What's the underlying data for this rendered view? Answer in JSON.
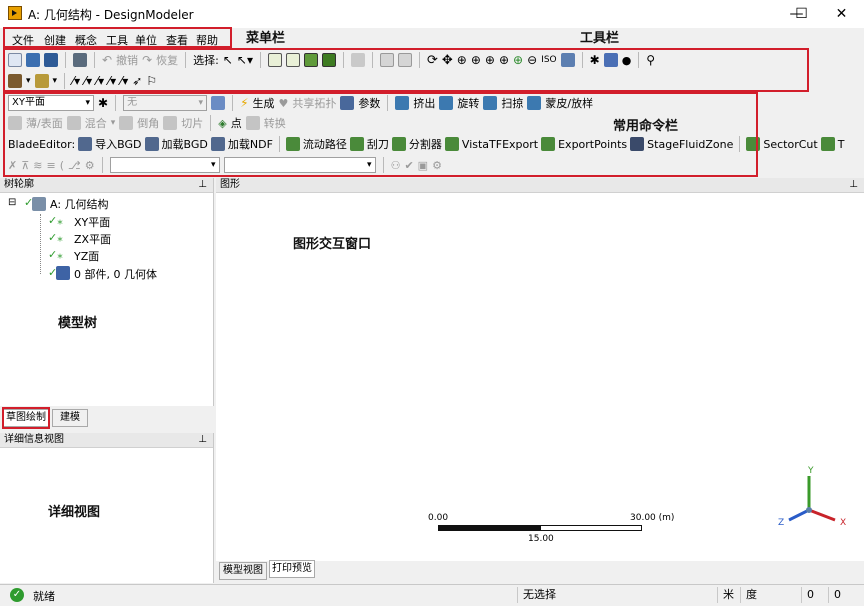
{
  "window": {
    "title": "A: 几何结构 - DesignModeler",
    "min": "—",
    "max": "☐",
    "close": "✕"
  },
  "menu": [
    "文件",
    "创建",
    "概念",
    "工具",
    "单位",
    "查看",
    "帮助"
  ],
  "annotations": {
    "menubar": "菜单栏",
    "toolbar": "工具栏",
    "commandbar": "常用命令栏",
    "graphics": "图形交互窗口",
    "tree": "模型树",
    "details": "详细视图"
  },
  "toolbar1": {
    "undo": "撤销",
    "redo": "恢复",
    "select": "选择:"
  },
  "commands1": {
    "plane": "XY平面",
    "sketch": "无",
    "generate": "生成",
    "share_topo": "共享拓扑",
    "params": "参数",
    "extrude": "挤出",
    "revolve": "旋转",
    "sweep": "扫掠",
    "skin": "蒙皮/放样"
  },
  "commands2": {
    "thin": "薄/表面",
    "blend": "混合",
    "chamfer": "倒角",
    "slice": "切片",
    "point": "点",
    "convert": "转换"
  },
  "commands3": {
    "label": "BladeEditor:",
    "items": [
      "导入BGD",
      "加载BGD",
      "加载NDF",
      "流动路径",
      "刮刀",
      "分割器",
      "VistaTFExport",
      "ExportPoints",
      "StageFluidZone",
      "SectorCut",
      "T"
    ]
  },
  "tree": {
    "header": "树轮廓",
    "pin": "꜖",
    "root": "A: 几何结构",
    "nodes": [
      "XY平面",
      "ZX平面",
      "YZ面",
      "0 部件, 0 几何体"
    ]
  },
  "left_tabs": {
    "sketch": "草图绘制",
    "model": "建模"
  },
  "details": {
    "header": "详细信息视图"
  },
  "graphics": {
    "header": "图形",
    "scale_min": "0.00",
    "scale_max": "30.00 (m)",
    "scale_mid": "15.00",
    "axes": {
      "x": "X",
      "y": "Y",
      "z": "Z"
    },
    "tabs": [
      "模型视图",
      "打印预览"
    ]
  },
  "status": {
    "ready": "就绪",
    "selection": "无选择",
    "unit_icon": "米",
    "unit": "度",
    "v1": "0",
    "v2": "0"
  },
  "colors": {
    "accent_red": "#d21e2b",
    "green_check": "#2e9b2e"
  }
}
